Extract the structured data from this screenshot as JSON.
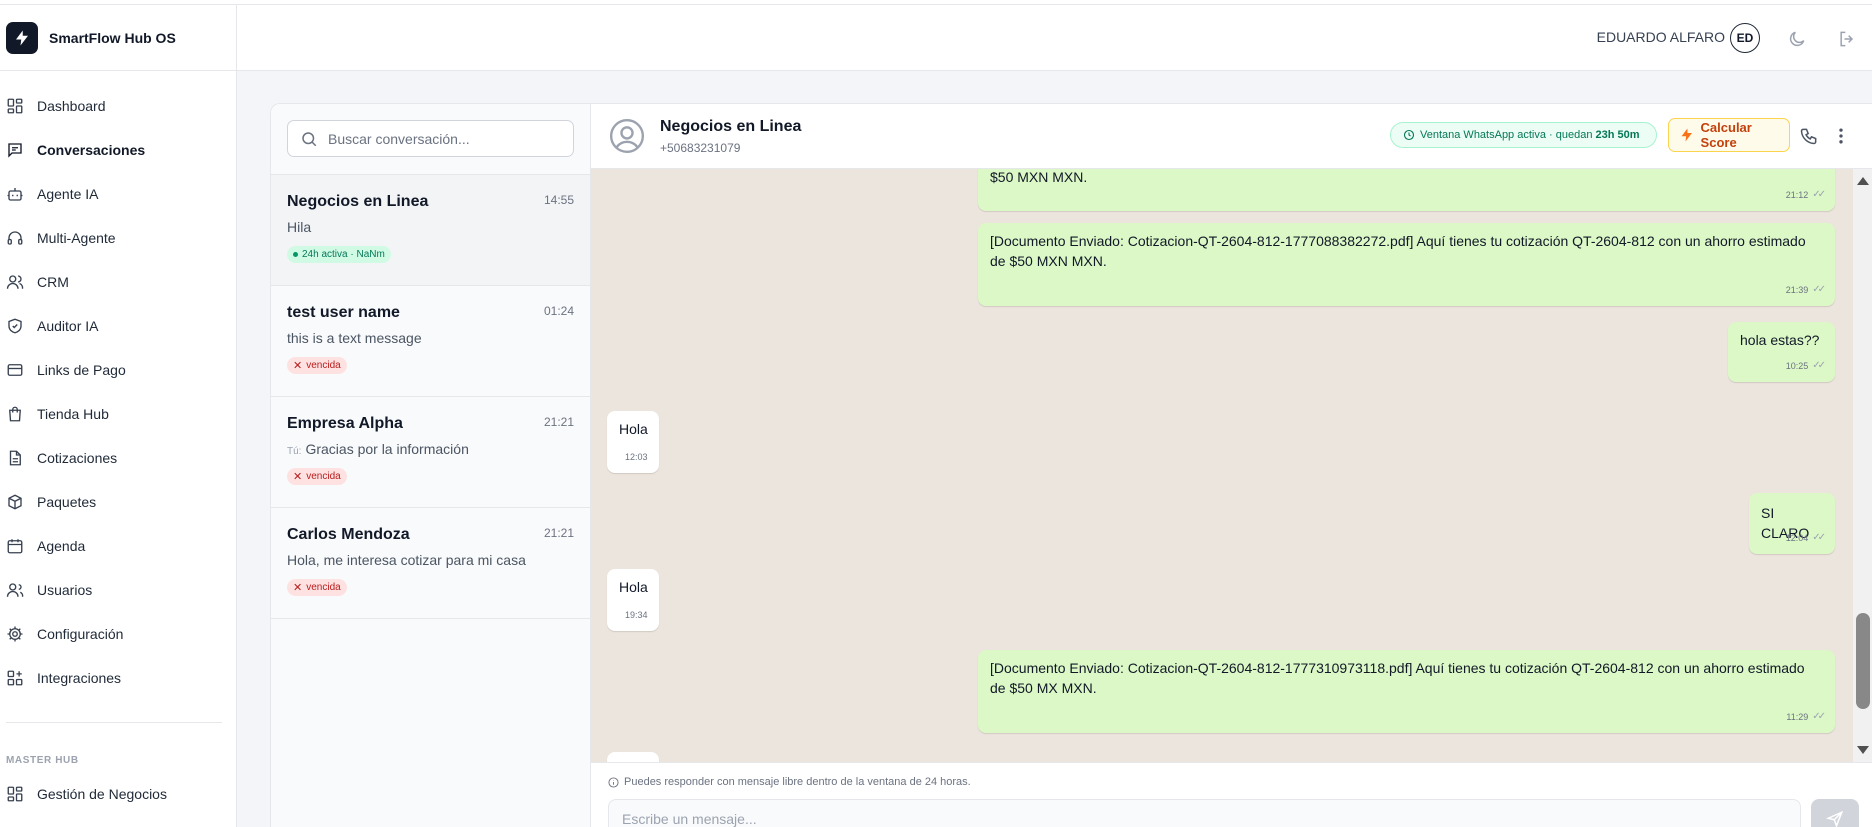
{
  "app": {
    "name": "SmartFlow Hub OS"
  },
  "sidebar": {
    "items": [
      {
        "label": "Dashboard",
        "icon": "dashboard-icon"
      },
      {
        "label": "Conversaciones",
        "icon": "chat-icon"
      },
      {
        "label": "Agente IA",
        "icon": "bot-icon"
      },
      {
        "label": "Multi-Agente",
        "icon": "headset-icon"
      },
      {
        "label": "CRM",
        "icon": "users-icon"
      },
      {
        "label": "Auditor IA",
        "icon": "shield-check-icon"
      },
      {
        "label": "Links de Pago",
        "icon": "credit-card-icon"
      },
      {
        "label": "Tienda Hub",
        "icon": "shopping-bag-icon"
      },
      {
        "label": "Cotizaciones",
        "icon": "document-icon"
      },
      {
        "label": "Paquetes",
        "icon": "package-icon"
      },
      {
        "label": "Agenda",
        "icon": "calendar-icon"
      },
      {
        "label": "Usuarios",
        "icon": "user-icon"
      },
      {
        "label": "Configuración",
        "icon": "gear-icon"
      },
      {
        "label": "Integraciones",
        "icon": "puzzle-icon"
      }
    ],
    "active_index": 1,
    "section_label": "MASTER HUB",
    "master_items": [
      {
        "label": "Gestión de Negocios",
        "icon": "grid-icon"
      }
    ]
  },
  "header": {
    "user_name": "EDUARDO ALFARO",
    "avatar_initials": "ED",
    "icons": [
      "moon-icon",
      "logout-icon"
    ]
  },
  "conversations": {
    "search_placeholder": "Buscar conversación...",
    "items": [
      {
        "name": "Negocios en Linea",
        "time": "14:55",
        "preview": "Hila",
        "you_prefix": "",
        "badge": "24h activa · NaNm",
        "status": "active"
      },
      {
        "name": "test user name",
        "time": "01:24",
        "preview": "this is a text message",
        "you_prefix": "",
        "badge": "vencida",
        "status": "expired"
      },
      {
        "name": "Empresa Alpha",
        "time": "21:21",
        "preview": "Gracias por la información",
        "you_prefix": "Tú:",
        "badge": "vencida",
        "status": "expired"
      },
      {
        "name": "Carlos Mendoza",
        "time": "21:21",
        "preview": "Hola, me interesa cotizar para mi casa",
        "you_prefix": "",
        "badge": "vencida",
        "status": "expired"
      }
    ]
  },
  "chat": {
    "contact_name": "Negocios en Linea",
    "contact_phone": "+50683231079",
    "window_status": "Ventana WhatsApp activa · quedan",
    "window_remaining": "23h 50m",
    "score_button": "Calcular Score",
    "messages": [
      {
        "direction": "out",
        "text": "$50 MXN MXN.",
        "time": "21:12"
      },
      {
        "direction": "out",
        "text": "[Documento Enviado: Cotizacion-QT-2604-812-1777088382272.pdf] Aquí tienes tu cotización QT-2604-812 con un ahorro estimado de $50 MXN MXN.",
        "time": "21:39"
      },
      {
        "direction": "out",
        "text": "hola estas??",
        "time": "10:25"
      },
      {
        "direction": "in",
        "text": "Hola",
        "time": "12:03"
      },
      {
        "direction": "out",
        "text": "SI CLARO",
        "time": "12:04"
      },
      {
        "direction": "in",
        "text": "Hola",
        "time": "19:34"
      },
      {
        "direction": "out",
        "text": "[Documento Enviado: Cotizacion-QT-2604-812-1777310973118.pdf] Aquí tienes tu cotización QT-2604-812 con un ahorro estimado de $50 MX MXN.",
        "time": "11:29"
      }
    ],
    "composer_hint": "Puedes responder con mensaje libre dentro de la ventana de 24 horas.",
    "composer_placeholder": "Escribe un mensaje..."
  },
  "colors": {
    "bubble_out": "#dcf8c6",
    "bubble_in": "#ffffff",
    "chat_bg": "#ece5dd",
    "active_badge": "#047857",
    "expired_badge": "#b91c1c",
    "score_accent": "#c2410c"
  }
}
